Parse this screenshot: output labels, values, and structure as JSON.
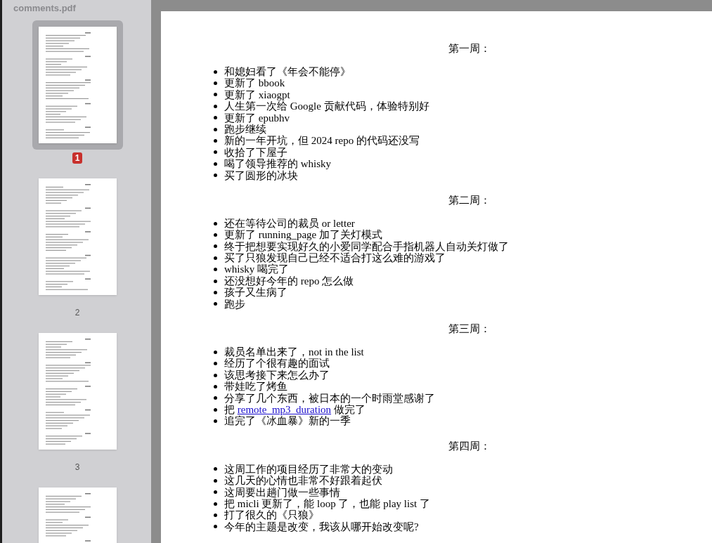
{
  "window": {
    "title": "comments.pdf"
  },
  "thumbnails": [
    {
      "label": "1",
      "selected": true
    },
    {
      "label": "2",
      "selected": false
    },
    {
      "label": "3",
      "selected": false
    },
    {
      "selected": false
    }
  ],
  "document": {
    "sections": [
      {
        "heading": "第一周：",
        "items": [
          {
            "kind": "text",
            "text": "和媳妇看了《年会不能停》"
          },
          {
            "kind": "text",
            "text": "更新了 bbook"
          },
          {
            "kind": "text",
            "text": "更新了 xiaogpt"
          },
          {
            "kind": "text",
            "text": "人生第一次给 Google 贡献代码，体验特别好"
          },
          {
            "kind": "text",
            "text": "更新了 epubhv"
          },
          {
            "kind": "text",
            "text": "跑步继续"
          },
          {
            "kind": "text",
            "text": "新的一年开坑，但 2024 repo 的代码还没写"
          },
          {
            "kind": "text",
            "text": "收拾了下屋子"
          },
          {
            "kind": "text",
            "text": "喝了领导推荐的 whisky"
          },
          {
            "kind": "text",
            "text": "买了圆形的冰块"
          }
        ]
      },
      {
        "heading": "第二周：",
        "items": [
          {
            "kind": "text",
            "text": "还在等待公司的裁员 or letter"
          },
          {
            "kind": "text",
            "text": "更新了 running_page 加了关灯模式"
          },
          {
            "kind": "text",
            "text": "终于把想要实现好久的小爱同学配合手指机器人自动关灯做了"
          },
          {
            "kind": "text",
            "text": "买了只狼发现自己已经不适合打这么难的游戏了"
          },
          {
            "kind": "text",
            "text": "whisky 喝完了"
          },
          {
            "kind": "text",
            "text": "还没想好今年的 repo 怎么做"
          },
          {
            "kind": "text",
            "text": "孩子又生病了"
          },
          {
            "kind": "text",
            "text": "跑步"
          }
        ]
      },
      {
        "heading": "第三周：",
        "items": [
          {
            "kind": "text",
            "text": "裁员名单出来了，not in the list"
          },
          {
            "kind": "text",
            "text": "经历了个很有趣的面试"
          },
          {
            "kind": "text",
            "text": "该思考接下来怎么办了"
          },
          {
            "kind": "text",
            "text": "带娃吃了烤鱼"
          },
          {
            "kind": "text",
            "text": "分享了几个东西，被日本的一个时雨堂感谢了"
          },
          {
            "kind": "link",
            "before": "把",
            "link": "remote_mp3_duration",
            "after": "做完了"
          },
          {
            "kind": "text",
            "text": "追完了《冰血暴》新的一季"
          }
        ]
      },
      {
        "heading": "第四周：",
        "items": [
          {
            "kind": "text",
            "text": "这周工作的项目经历了非常大的变动"
          },
          {
            "kind": "text",
            "text": "这几天的心情也非常不好跟着起伏"
          },
          {
            "kind": "text",
            "text": "这周要出趟门做一些事情"
          },
          {
            "kind": "text",
            "text": "把 micli 更新了，能 loop 了，也能 play list 了"
          },
          {
            "kind": "text",
            "text": "打了很久的《只狼》"
          },
          {
            "kind": "text",
            "text": "今年的主题是改变，我该从哪开始改变呢?"
          }
        ]
      }
    ]
  }
}
